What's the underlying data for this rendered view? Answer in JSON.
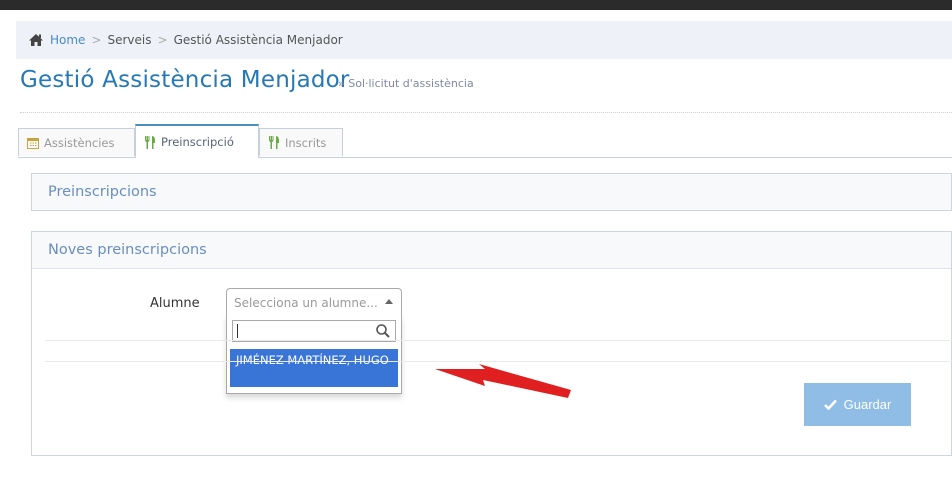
{
  "breadcrumb": {
    "home": "Home",
    "separator": ">",
    "items": [
      "Serveis",
      "Gestió Assistència Menjador"
    ]
  },
  "header": {
    "title": "Gestió Assistència Menjador",
    "subtitle": "» Sol·licitut d'assistència"
  },
  "tabs": [
    {
      "label": "Assistències",
      "icon": "calendar-icon",
      "active": false
    },
    {
      "label": "Preinscripció",
      "icon": "cutlery-icon",
      "active": true
    },
    {
      "label": "Inscrits",
      "icon": "cutlery-icon",
      "active": false
    }
  ],
  "panels": {
    "preinscripcions": {
      "title": "Preinscripcions"
    },
    "noves": {
      "title": "Noves preinscripcions"
    }
  },
  "form": {
    "alumne_label": "Alumne",
    "select_placeholder": "Selecciona un alumne...",
    "search_value": "",
    "options": [
      "JIMÉNEZ MARTÍNEZ, HUGO"
    ]
  },
  "actions": {
    "save_label": "Guardar"
  },
  "colors": {
    "accent": "#2679b5",
    "tab_active_border": "#4c8fbd",
    "option_highlight": "#3875d7",
    "save_button": "#8fbde5",
    "annotation_arrow": "#e02020",
    "icon_green": "#69aa46"
  }
}
